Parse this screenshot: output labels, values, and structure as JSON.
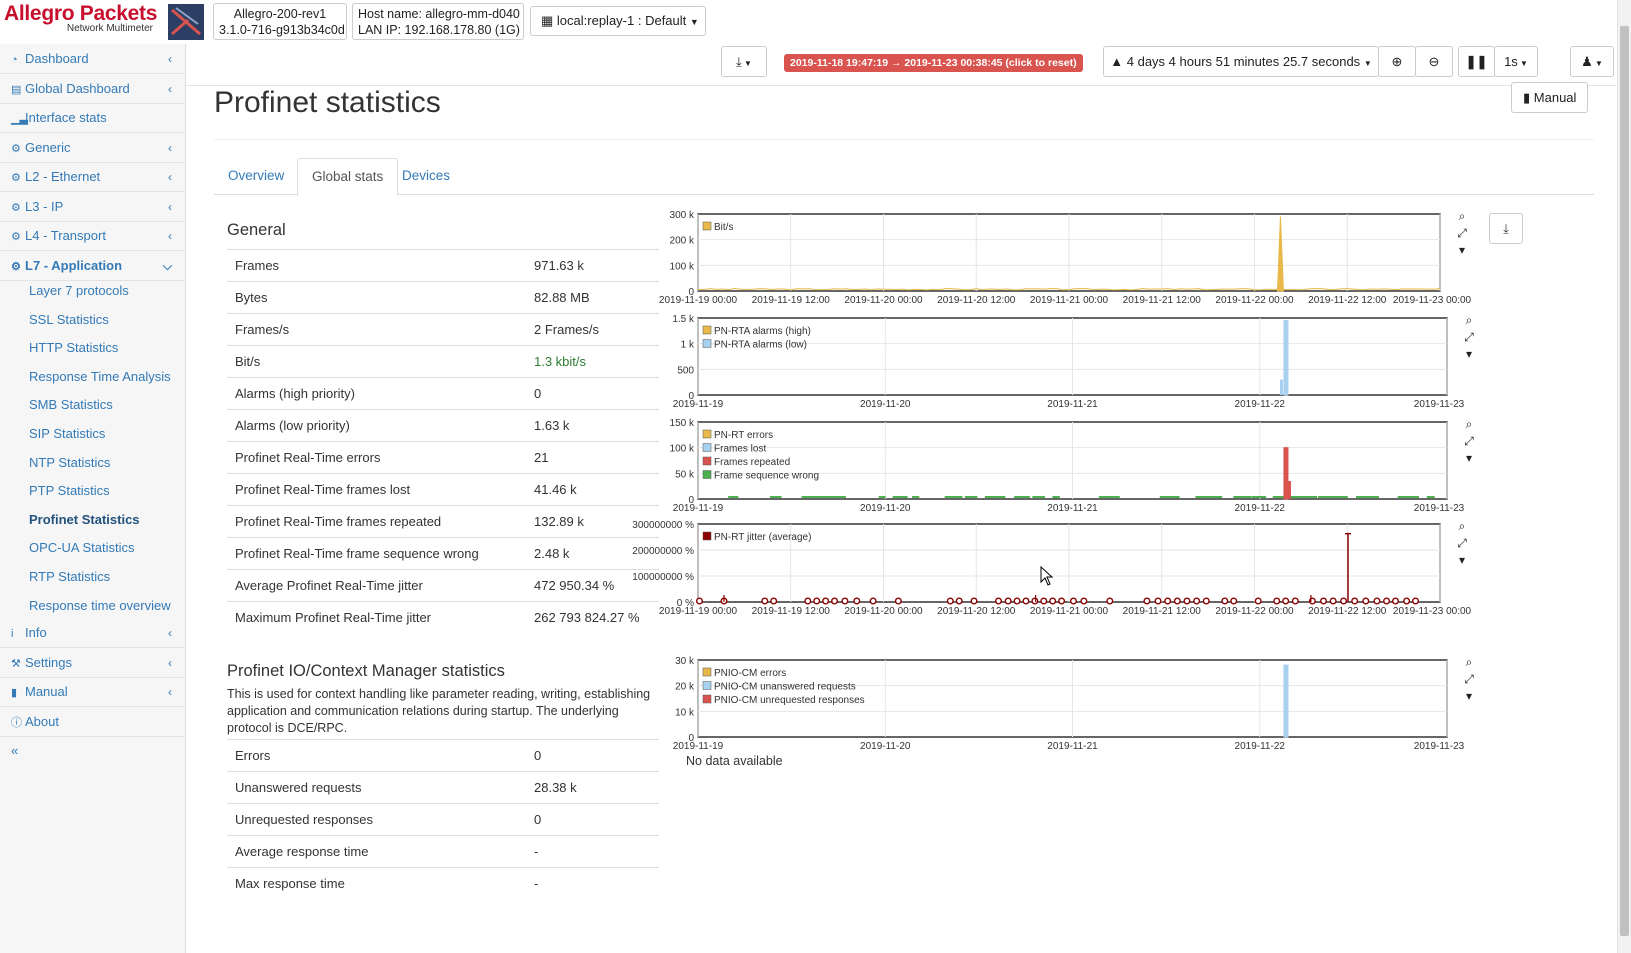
{
  "brand": {
    "name": "Allegro Packets",
    "subtitle": "Network Multimeter"
  },
  "header": {
    "device_line1": "Allegro-200-rev1",
    "device_line2": "3.1.0-716-g913b34c0d",
    "host_line1": "Host name: allegro-mm-d040",
    "host_line2": "LAN IP: 192.168.178.80 (1G)",
    "replay_label": "local:replay-1 : Default"
  },
  "toolbar": {
    "time_range": "2019-11-18 19:47:19 → 2019-11-23 00:38:45  (click to reset)",
    "duration": "4 days 4 hours 51 minutes 25.7 seconds",
    "interval": "1s"
  },
  "sidebar": {
    "items": [
      {
        "label": "Dashboard",
        "icon": "dashboard-icon",
        "chevron": true
      },
      {
        "label": "Global Dashboard",
        "icon": "global-dashboard-icon",
        "chevron": true
      },
      {
        "label": "Interface stats",
        "icon": "bar-chart-icon",
        "chevron": false
      },
      {
        "label": "Generic",
        "icon": "gear-icon",
        "chevron": true
      },
      {
        "label": "L2 - Ethernet",
        "icon": "gear-icon",
        "chevron": true
      },
      {
        "label": "L3 - IP",
        "icon": "gear-icon",
        "chevron": true
      },
      {
        "label": "L4 - Transport",
        "icon": "gear-icon",
        "chevron": true
      },
      {
        "label": "L7 - Application",
        "icon": "gear-icon",
        "chevron": true
      }
    ],
    "l7_sub": [
      "Layer 7 protocols",
      "SSL Statistics",
      "HTTP Statistics",
      "Response Time Analysis",
      "SMB Statistics",
      "SIP Statistics",
      "NTP Statistics",
      "PTP Statistics",
      "Profinet Statistics",
      "OPC-UA Statistics",
      "RTP Statistics",
      "Response time overview"
    ],
    "bottom_items": [
      {
        "label": "Info",
        "icon": "info-icon",
        "chevron": true
      },
      {
        "label": "Settings",
        "icon": "wrench-icon",
        "chevron": true
      },
      {
        "label": "Manual",
        "icon": "book-icon",
        "chevron": true
      },
      {
        "label": "About",
        "icon": "info-circle-icon",
        "chevron": false
      }
    ],
    "collapse": "«"
  },
  "page": {
    "title": "Profinet statistics",
    "manual_button": "Manual",
    "tabs": [
      "Overview",
      "Global stats",
      "Devices"
    ],
    "active_tab": 1
  },
  "general": {
    "title": "General",
    "rows": [
      {
        "key": "Frames",
        "value": "971.63 k"
      },
      {
        "key": "Bytes",
        "value": "82.88 MB"
      },
      {
        "key": "Frames/s",
        "value": "2 Frames/s"
      },
      {
        "key": "Bit/s",
        "value": "1.3 kbit/s"
      },
      {
        "key": "Alarms (high priority)",
        "value": "0"
      },
      {
        "key": "Alarms (low priority)",
        "value": "1.63 k"
      },
      {
        "key": "Profinet Real-Time errors",
        "value": "21"
      },
      {
        "key": "Profinet Real-Time frames lost",
        "value": "41.46 k"
      },
      {
        "key": "Profinet Real-Time frames repeated",
        "value": "132.89 k"
      },
      {
        "key": "Profinet Real-Time frame sequence wrong",
        "value": "2.48 k"
      },
      {
        "key": "Average Profinet Real-Time jitter",
        "value": "472 950.34 %"
      },
      {
        "key": "Maximum Profinet Real-Time jitter",
        "value": "262 793 824.27 %"
      }
    ]
  },
  "io_cm": {
    "title": "Profinet IO/Context Manager statistics",
    "description": "This is used for context handling like parameter reading, writing, establishing application and communication relations during startup. The underlying protocol is DCE/RPC.",
    "rows": [
      {
        "key": "Errors",
        "value": "0"
      },
      {
        "key": "Unanswered requests",
        "value": "28.38 k"
      },
      {
        "key": "Unrequested responses",
        "value": "0"
      },
      {
        "key": "Average response time",
        "value": "-"
      },
      {
        "key": "Max response time",
        "value": "-"
      }
    ],
    "no_data": "No data available"
  },
  "chart_data": [
    {
      "type": "area",
      "series": [
        {
          "name": "Bit/s",
          "color": "#e8b84a",
          "spike_x": 0.785,
          "spike_value": 290000
        }
      ],
      "yticks": [
        "300 k",
        "200 k",
        "100 k",
        "0"
      ],
      "xticks": [
        "2019-11-19 00:00",
        "2019-11-19 12:00",
        "2019-11-20 00:00",
        "2019-11-20 12:00",
        "2019-11-21 00:00",
        "2019-11-21 12:00",
        "2019-11-22 00:00",
        "2019-11-22 12:00",
        "2019-11-23 00:00"
      ],
      "ylim": [
        0,
        300000
      ]
    },
    {
      "type": "bar",
      "series": [
        {
          "name": "PN-RTA alarms (high)",
          "color": "#e8b84a"
        },
        {
          "name": "PN-RTA alarms (low)",
          "color": "#a8d1f0",
          "spike_x": 0.785,
          "spike_value": 1450
        }
      ],
      "yticks": [
        "1.5 k",
        "1 k",
        "500",
        "0"
      ],
      "xticks": [
        "2019-11-19",
        "2019-11-20",
        "2019-11-21",
        "2019-11-22",
        "2019-11-23"
      ],
      "ylim": [
        0,
        1500
      ]
    },
    {
      "type": "bar",
      "series": [
        {
          "name": "PN-RT errors",
          "color": "#e8b84a"
        },
        {
          "name": "Frames lost",
          "color": "#a8d1f0"
        },
        {
          "name": "Frames repeated",
          "color": "#d9534f",
          "spike_x": 0.785,
          "spike_value": 100000
        },
        {
          "name": "Frame sequence wrong",
          "color": "#4caf50"
        }
      ],
      "yticks": [
        "150 k",
        "100 k",
        "50 k",
        "0"
      ],
      "xticks": [
        "2019-11-19",
        "2019-11-20",
        "2019-11-21",
        "2019-11-22",
        "2019-11-23"
      ],
      "ylim": [
        0,
        150000
      ]
    },
    {
      "type": "line",
      "series": [
        {
          "name": "PN-RT jitter (average)",
          "color": "#8b0000",
          "spike_x": 0.876,
          "spike_value": 262793824
        }
      ],
      "yticks": [
        "300000000 %",
        "200000000 %",
        "100000000 %",
        "0 %"
      ],
      "xticks": [
        "2019-11-19 00:00",
        "2019-11-19 12:00",
        "2019-11-20 00:00",
        "2019-11-20 12:00",
        "2019-11-21 00:00",
        "2019-11-21 12:00",
        "2019-11-22 00:00",
        "2019-11-22 12:00",
        "2019-11-23 00:00"
      ],
      "ylim": [
        0,
        300000000
      ]
    },
    {
      "type": "bar",
      "series": [
        {
          "name": "PNIO-CM errors",
          "color": "#e8b84a"
        },
        {
          "name": "PNIO-CM unanswered requests",
          "color": "#a8d1f0",
          "spike_x": 0.785,
          "spike_value": 28000
        },
        {
          "name": "PNIO-CM unrequested responses",
          "color": "#d9534f"
        }
      ],
      "yticks": [
        "30 k",
        "20 k",
        "10 k",
        "0"
      ],
      "xticks": [
        "2019-11-19",
        "2019-11-20",
        "2019-11-21",
        "2019-11-22",
        "2019-11-23"
      ],
      "ylim": [
        0,
        30000
      ]
    }
  ]
}
